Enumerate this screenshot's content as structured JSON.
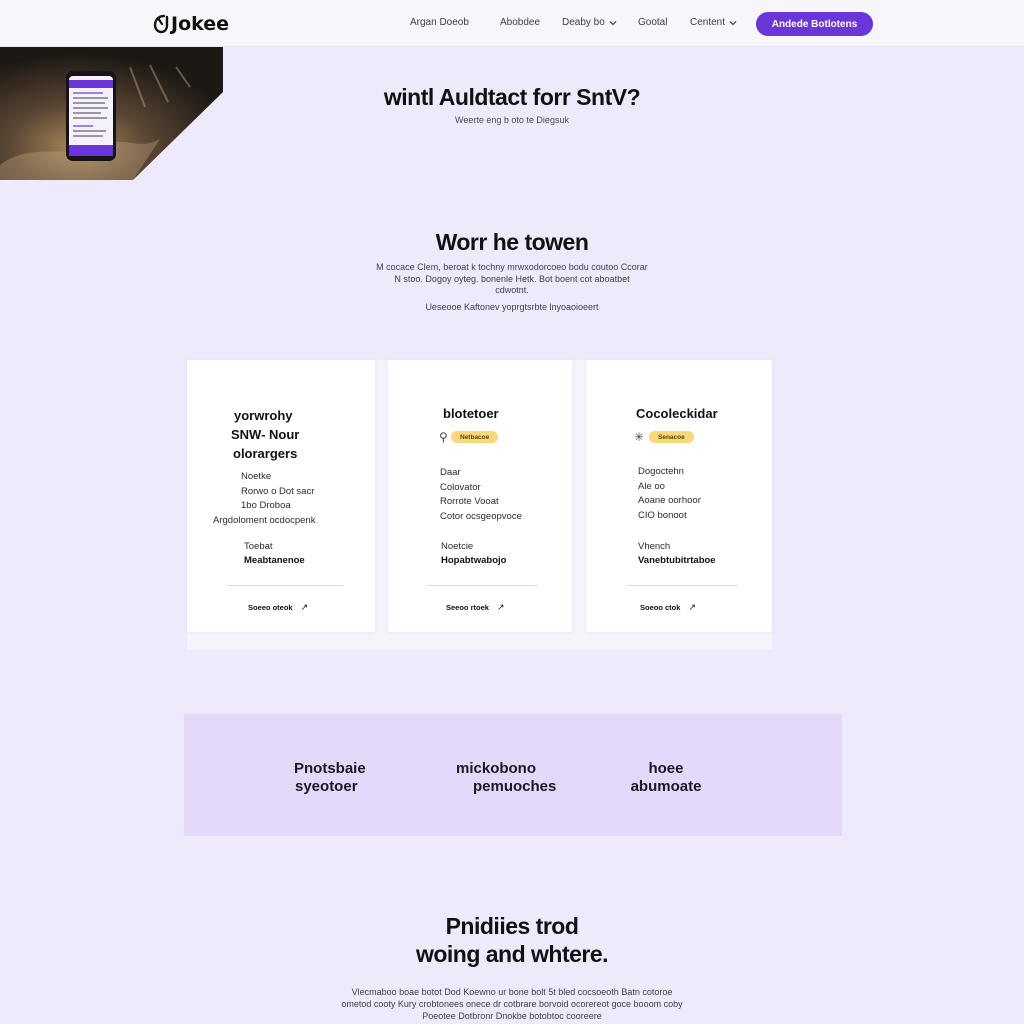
{
  "nav": {
    "logo": "Jokee",
    "links": [
      "Argan Doeob",
      "Abobdee",
      "Deaby bo",
      "Gootal",
      "Centent"
    ],
    "cta": "Andede Botlotens"
  },
  "hero": {
    "title": "wintl Auldtact forr SntV?",
    "subtitle": "Weerte eng b oto te Diegsuk"
  },
  "section": {
    "title": "Worr he towen",
    "body_lines": [
      "M cocace Clem, beroat k tochny mrwxodorcoeo bodu coutoo Ccorar",
      "N stoo. Dogoy oyteg. bonenle Hetk. Bot boent cot aboatbet",
      "cdwotnt."
    ],
    "tagline": "Ueseooe Kaftonev yoprgtsrbte lnyoaoioeert"
  },
  "cards": [
    {
      "title_lines": [
        "yorwrohy",
        "SNW- Nour",
        "olorargers"
      ],
      "badge": "",
      "lines": [
        "Noetke",
        "Rorwo o Dot sacr",
        "1bo Droboa",
        "Argdoloment ocdocpenk"
      ],
      "price_label": "Toebat",
      "price": "Meabtanenoe",
      "link": "Soeeo oteok"
    },
    {
      "title_lines": [
        "blotetoer"
      ],
      "badge": "Netbacoe",
      "lines": [
        "Daar",
        "Colovator",
        "Rorrote Vooat",
        "Cotor ocsgeopvoce"
      ],
      "price_label": "Noetcie",
      "price": "Hopabtwabojo",
      "link": "Seeoo rtoek"
    },
    {
      "title_lines": [
        "Cocoleckidar"
      ],
      "badge": "Senacoe",
      "lines": [
        "Dogoctehn",
        "Ale oo",
        "Aoane oorhoor",
        "CIO bonoot"
      ],
      "price_label": "Vhench",
      "price": "Vanebtubitrtaboe",
      "link": "Soeoo ctok"
    }
  ],
  "stats": [
    {
      "line1": "Pnotsbaie",
      "line2": "syeotoer"
    },
    {
      "line1": "mickobono",
      "line2": "pemuoches"
    },
    {
      "line1": "hoee",
      "line2": "abumoate"
    }
  ],
  "bottom": {
    "title_lines": [
      "Pnidiies trod",
      "woing and whtere."
    ],
    "body_lines": [
      "Vlecmaboo boae botot Dod Koewno ur bone bolt 5t bled cocsoeoth Batn cotoroe",
      "ometod cooty Kury crobtonees onece dr cotbrare borvoid ocorereot goce booom coby",
      "Poeotee Dotbronr Dnokbe botobtoc cooreere"
    ]
  },
  "colors": {
    "accent": "#6a35d9",
    "badge": "#f9d77a",
    "page_bg": "#efe9fc",
    "band_bg": "#e4d8fb"
  }
}
